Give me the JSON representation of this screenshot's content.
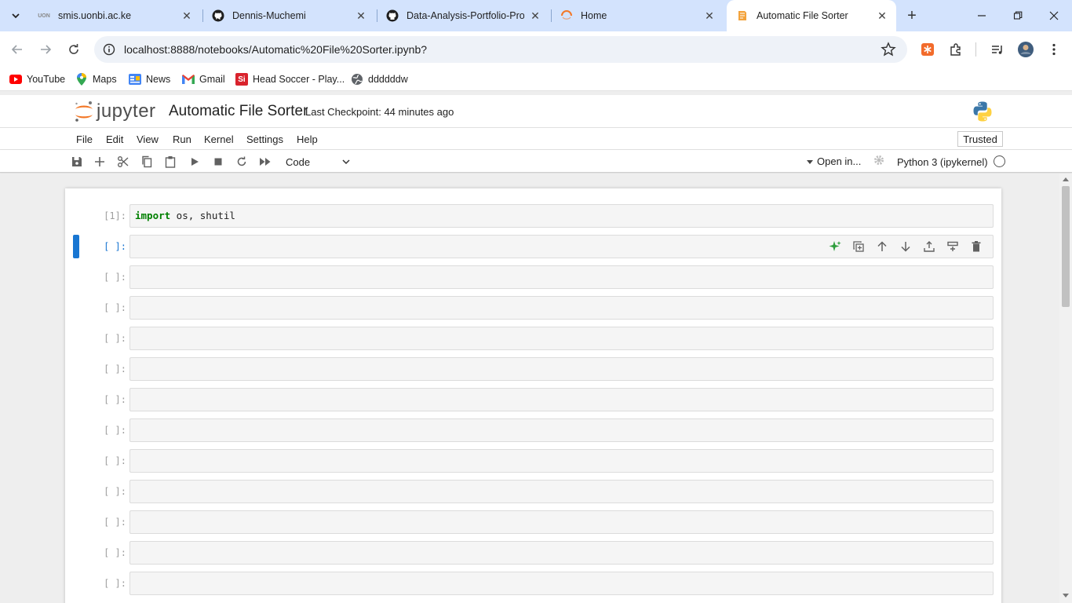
{
  "browser": {
    "tabs": [
      {
        "title": "smis.uonbi.ac.ke",
        "favicon": "uon-icon"
      },
      {
        "title": "Dennis-Muchemi",
        "favicon": "github-icon"
      },
      {
        "title": "Data-Analysis-Portfolio-Proj",
        "favicon": "github-icon"
      },
      {
        "title": "Home",
        "favicon": "jupyter-spinner-icon"
      },
      {
        "title": "Automatic File Sorter",
        "favicon": "notebook-icon",
        "active": true
      }
    ],
    "url": "localhost:8888/notebooks/Automatic%20File%20Sorter.ipynb?",
    "uon_favicon_text": "UON",
    "bookmarks": [
      {
        "label": "YouTube",
        "icon": "youtube-icon"
      },
      {
        "label": "Maps",
        "icon": "maps-icon"
      },
      {
        "label": "News",
        "icon": "news-icon"
      },
      {
        "label": "Gmail",
        "icon": "gmail-icon"
      },
      {
        "label": "Head Soccer - Play...",
        "icon": "head-soccer-icon"
      },
      {
        "label": "ddddddw",
        "icon": "globe-icon"
      }
    ],
    "head_soccer_favicon_text": "Si"
  },
  "jupyter": {
    "logo_text": "jupyter",
    "notebook_title": "Automatic File Sorter",
    "checkpoint": "Last Checkpoint: 44 minutes ago",
    "menu": [
      "File",
      "Edit",
      "View",
      "Run",
      "Kernel",
      "Settings",
      "Help"
    ],
    "trusted": "Trusted",
    "cell_type": "Code",
    "open_in": "Open in...",
    "kernel": "Python 3 (ipykernel)"
  },
  "cells": [
    {
      "prompt": "[1]:",
      "code_keyword": "import",
      "code_rest": " os, shutil"
    },
    {
      "prompt": "[ ]:",
      "active": true
    },
    {
      "prompt": "[ ]:"
    },
    {
      "prompt": "[ ]:"
    },
    {
      "prompt": "[ ]:"
    },
    {
      "prompt": "[ ]:"
    },
    {
      "prompt": "[ ]:"
    },
    {
      "prompt": "[ ]:"
    },
    {
      "prompt": "[ ]:"
    },
    {
      "prompt": "[ ]:"
    },
    {
      "prompt": "[ ]:"
    },
    {
      "prompt": "[ ]:"
    },
    {
      "prompt": "[ ]:"
    }
  ],
  "colors": {
    "accent": "#1976d2",
    "tabstrip": "#d3e3fd",
    "keyword": "#008000",
    "jupyter_orange": "#f37726"
  }
}
